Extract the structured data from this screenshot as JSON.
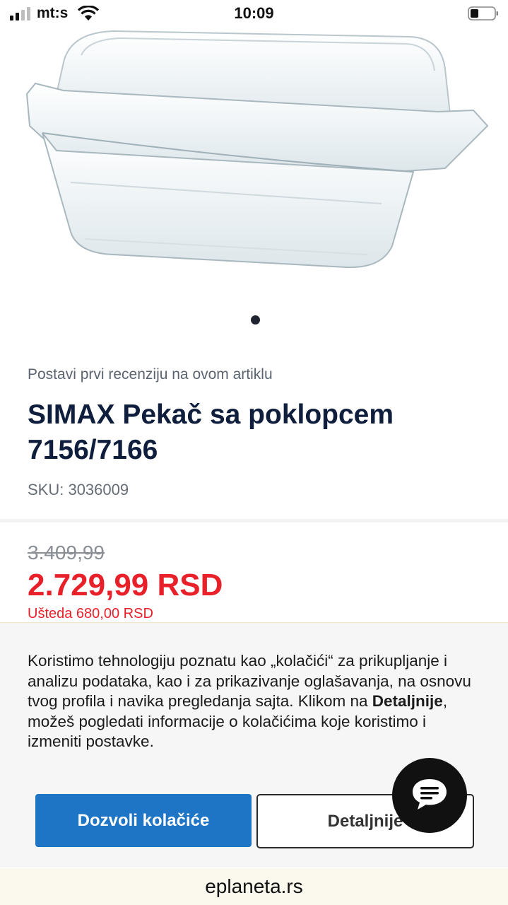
{
  "status_bar": {
    "carrier": "mt:s",
    "time": "10:09"
  },
  "product": {
    "review_prompt": "Postavi prvi recenziju na ovom artiklu",
    "title": "SIMAX Pekač sa poklopcem 7156/7166",
    "sku": "SKU: 3036009",
    "old_price": "3.409,99",
    "new_price": "2.729,99 RSD",
    "savings": "Ušteda 680,00 RSD",
    "image_icon": "glass-baking-dish"
  },
  "carousel": {
    "current": 1,
    "total": 1
  },
  "cookie_banner": {
    "text_before": "Koristimo tehnologiju poznatu kao „kolačići“ za prikupljanje i analizu podataka, kao i za prikazivanje oglašavanja, na osnovu tvog profila i navika pregledanja sajta. Klikom na ",
    "text_bold": "Detaljnije",
    "text_after": ", možeš pogledati informacije o kolačićima koje koristimo i izmeniti postavke.",
    "allow_label": "Dozvoli kolačiće",
    "details_label": "Detaljnije"
  },
  "chat": {
    "icon": "chat-bubble-icon"
  },
  "browser": {
    "url": "eplaneta.rs"
  },
  "colors": {
    "title": "#0f1e3c",
    "price": "#e8202a",
    "button": "#1f75c5"
  }
}
